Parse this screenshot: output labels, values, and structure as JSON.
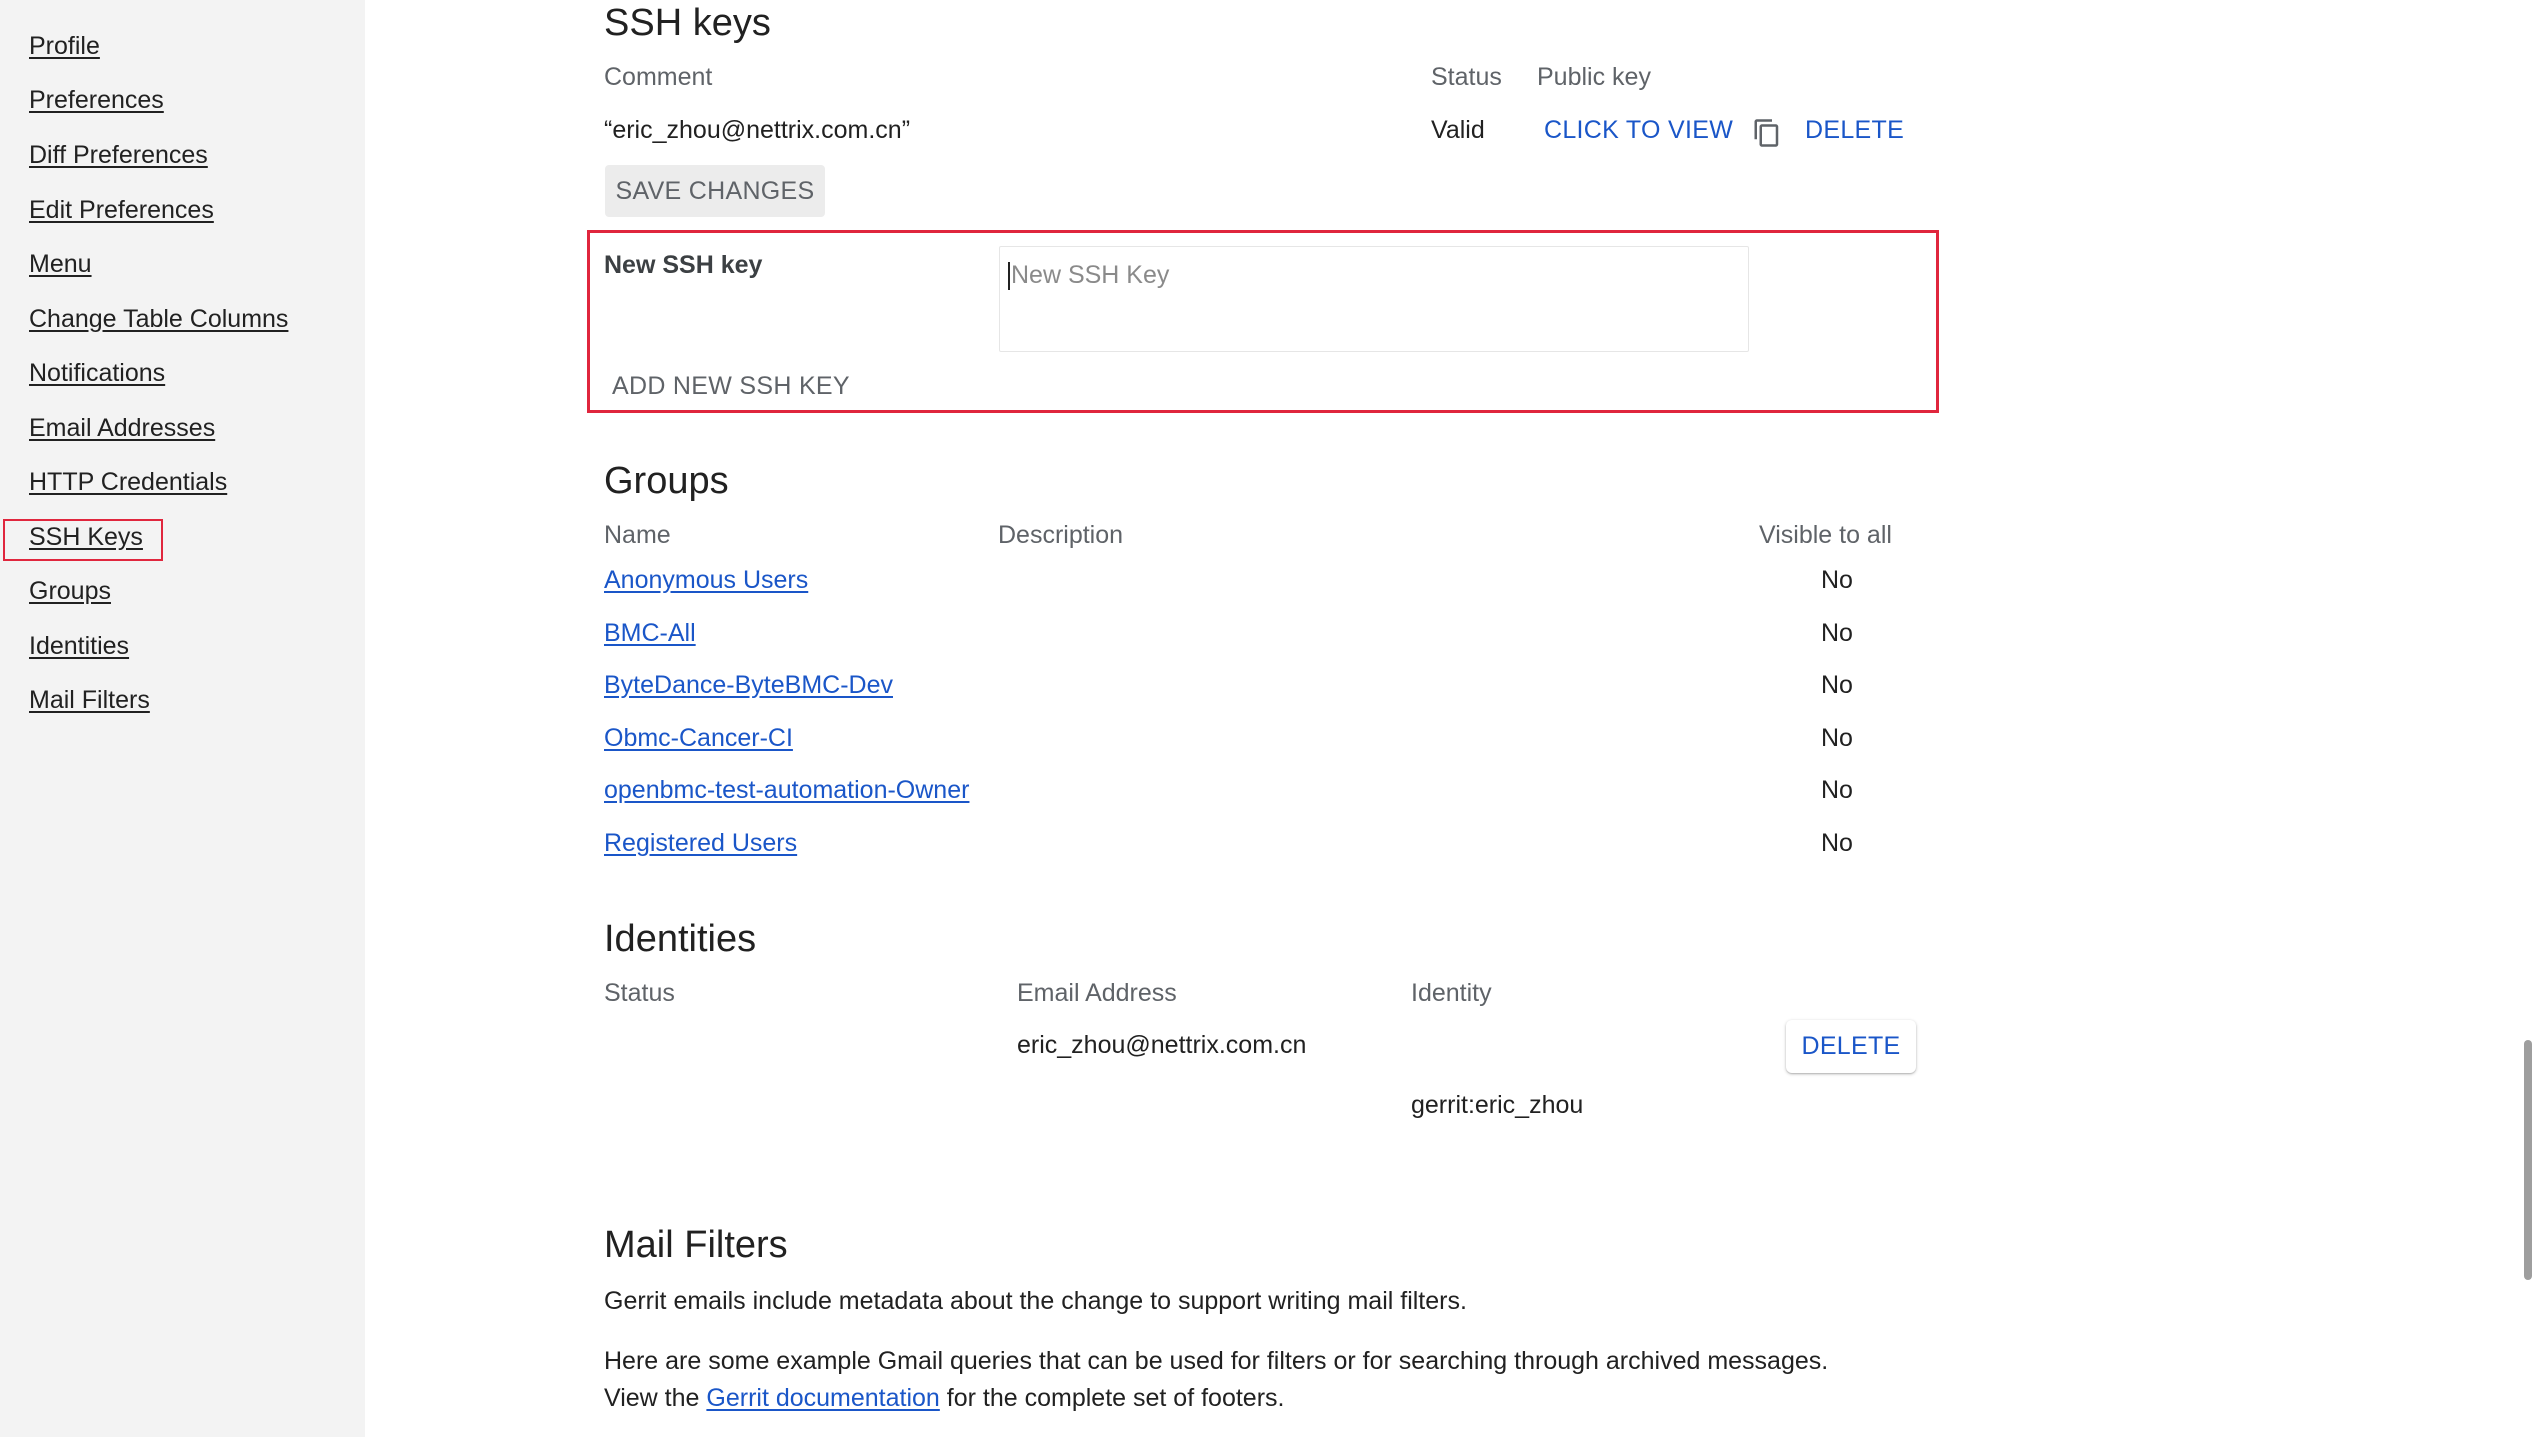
{
  "sidebar": {
    "items": [
      {
        "label": "Profile"
      },
      {
        "label": "Preferences"
      },
      {
        "label": "Diff Preferences"
      },
      {
        "label": "Edit Preferences"
      },
      {
        "label": "Menu"
      },
      {
        "label": "Change Table Columns"
      },
      {
        "label": "Notifications"
      },
      {
        "label": "Email Addresses"
      },
      {
        "label": "HTTP Credentials"
      },
      {
        "label": "SSH Keys"
      },
      {
        "label": "Groups"
      },
      {
        "label": "Identities"
      },
      {
        "label": "Mail Filters"
      }
    ],
    "highlighted_item": "SSH Keys"
  },
  "ssh_keys": {
    "title": "SSH keys",
    "headers": {
      "comment": "Comment",
      "status": "Status",
      "public_key": "Public key"
    },
    "rows": [
      {
        "comment": "“eric_zhou@nettrix.com.cn”",
        "status": "Valid",
        "view_label": "CLICK TO VIEW",
        "copy_icon": "copy-icon",
        "delete_label": "DELETE"
      }
    ],
    "save_label": "SAVE CHANGES",
    "new_key": {
      "label": "New SSH key",
      "placeholder": "New SSH Key",
      "add_label": "ADD NEW SSH KEY"
    }
  },
  "groups": {
    "title": "Groups",
    "headers": {
      "name": "Name",
      "description": "Description",
      "visible": "Visible to all"
    },
    "rows": [
      {
        "name": "Anonymous Users",
        "visible": "No"
      },
      {
        "name": "BMC-All",
        "visible": "No"
      },
      {
        "name": "ByteDance-ByteBMC-Dev",
        "visible": "No"
      },
      {
        "name": "Obmc-Cancer-CI",
        "visible": "No"
      },
      {
        "name": "openbmc-test-automation-Owner",
        "visible": "No"
      },
      {
        "name": "Registered Users",
        "visible": "No"
      }
    ]
  },
  "identities": {
    "title": "Identities",
    "headers": {
      "status": "Status",
      "email": "Email Address",
      "identity": "Identity"
    },
    "rows": [
      {
        "email": "eric_zhou@nettrix.com.cn",
        "identity": "gerrit:eric_zhou",
        "delete_label": "DELETE"
      }
    ]
  },
  "mail_filters": {
    "title": "Mail Filters",
    "para1": "Gerrit emails include metadata about the change to support writing mail filters.",
    "para2_line1": "Here are some example Gmail queries that can be used for filters or for searching through archived messages.",
    "para2_prefix": "View the",
    "doc_link": "Gerrit documentation",
    "para2_suffix": "for the complete set of footers."
  },
  "colors": {
    "link": "#1a56c8",
    "highlight_border": "#e0263d",
    "sidebar_bg": "#f3f3f3"
  }
}
